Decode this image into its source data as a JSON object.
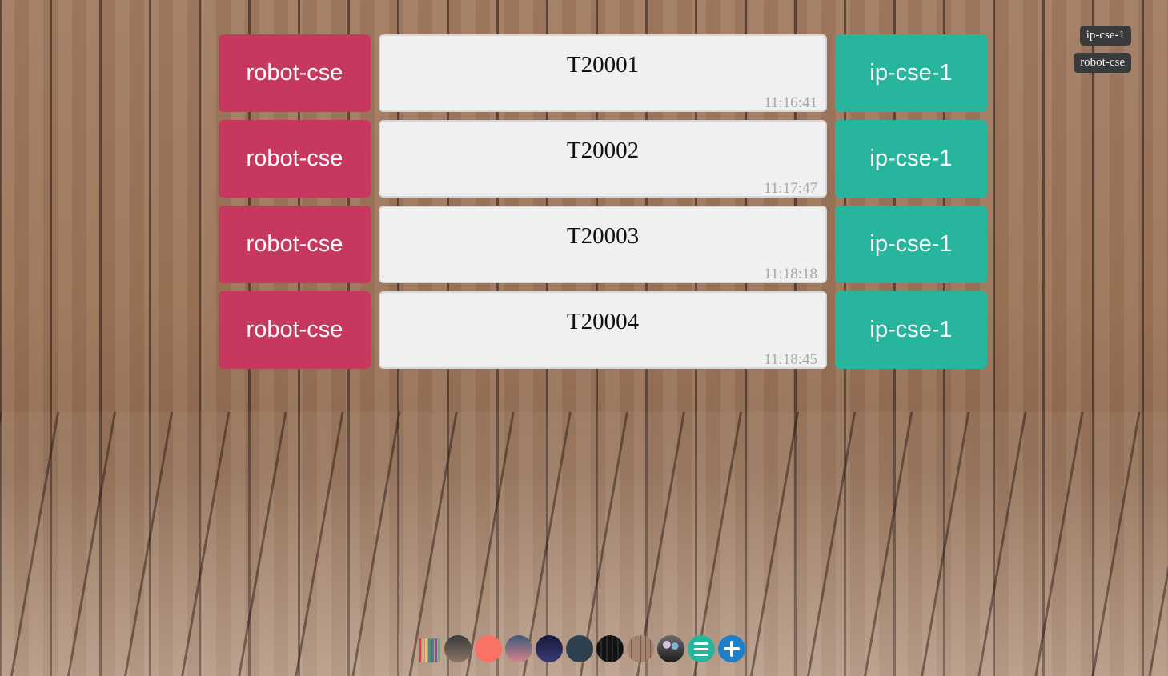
{
  "rows": [
    {
      "left_tag": "robot-cse",
      "title": "T20001",
      "time": "11:16:41",
      "right_tag": "ip-cse-1"
    },
    {
      "left_tag": "robot-cse",
      "title": "T20002",
      "time": "11:17:47",
      "right_tag": "ip-cse-1"
    },
    {
      "left_tag": "robot-cse",
      "title": "T20003",
      "time": "11:18:18",
      "right_tag": "ip-cse-1"
    },
    {
      "left_tag": "robot-cse",
      "title": "T20004",
      "time": "11:18:45",
      "right_tag": "ip-cse-1"
    }
  ],
  "legend": [
    "ip-cse-1",
    "robot-cse"
  ],
  "colors": {
    "left_tag": "#c7385f",
    "right_tag": "#27b59d",
    "card_bg": "#f0f0f0",
    "add_button": "#1f7fc8"
  },
  "dock": {
    "items": [
      {
        "name": "colored-pencils-icon"
      },
      {
        "name": "theme-swatch-dark-gradient"
      },
      {
        "name": "theme-swatch-coral"
      },
      {
        "name": "theme-swatch-dusk-gradient"
      },
      {
        "name": "theme-swatch-navy-gradient"
      },
      {
        "name": "theme-swatch-slate"
      },
      {
        "name": "theme-swatch-black-wood"
      },
      {
        "name": "theme-swatch-light-wood"
      },
      {
        "name": "theme-swatch-balloons"
      },
      {
        "name": "menu-icon"
      },
      {
        "name": "add-icon"
      }
    ]
  }
}
